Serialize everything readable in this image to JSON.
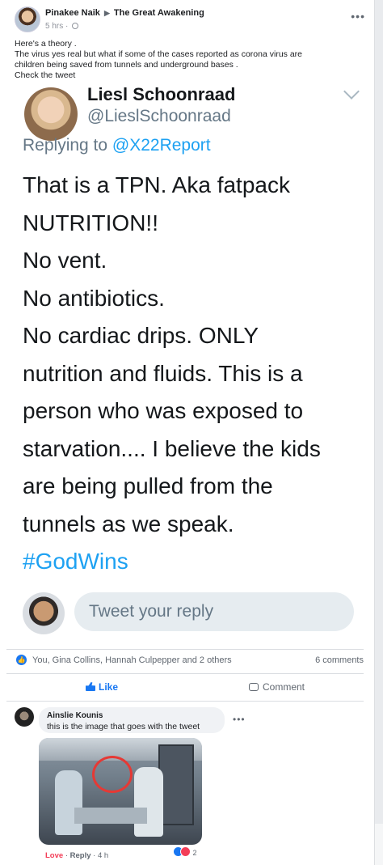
{
  "post": {
    "author": "Pinakee Naik",
    "group": "The Great Awakening",
    "time": "5 hrs ·",
    "text": [
      "Here's a theory .",
      "The virus yes real but what if some of the cases reported as corona virus are",
      "children being saved from tunnels and underground bases .",
      "Check the tweet"
    ]
  },
  "tweet": {
    "name": "Liesl Schoonraad",
    "handle": "@LieslSchoonraad",
    "replying_prefix": "Replying to ",
    "replying_to": "@X22Report",
    "lines": [
      "That is a TPN. Aka fatpack",
      "NUTRITION!!",
      "No vent.",
      "No antibiotics.",
      "No cardiac drips.   ONLY",
      "nutrition and fluids. This is a",
      "person who was exposed to",
      "starvation.... I believe the kids",
      "are being pulled from the",
      "tunnels as we speak."
    ],
    "hashtag": "#GodWins",
    "reply_placeholder": "Tweet your reply"
  },
  "reactions": {
    "names": "You, Gina Collins, Hannah Culpepper and 2 others",
    "comments": "6 comments"
  },
  "actions": {
    "like": "Like",
    "comment": "Comment"
  },
  "comment": {
    "author": "Ainslie Kounis",
    "text": "this is the image that goes with the tweet",
    "love": "Love",
    "reply": "Reply",
    "time": "4 h",
    "reaction_count": "2"
  }
}
